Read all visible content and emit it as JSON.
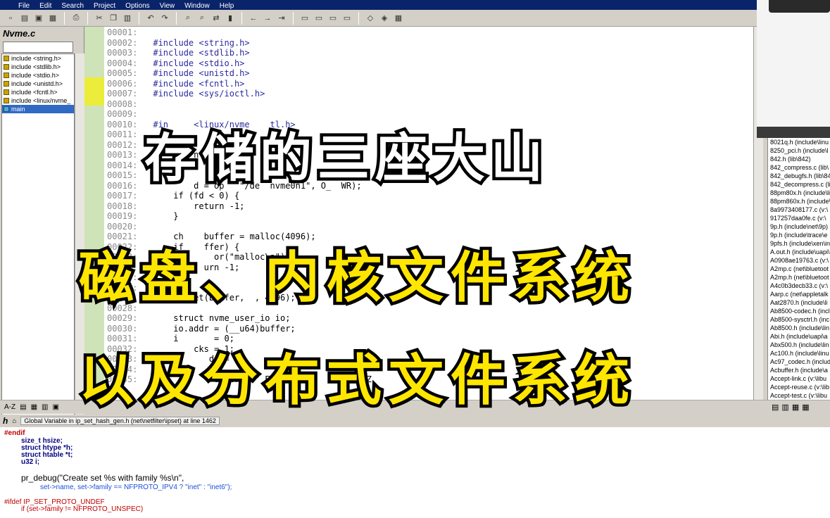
{
  "window": {
    "title": "",
    "menu": [
      "File",
      "Edit",
      "Search",
      "Project",
      "Options",
      "View",
      "Window",
      "Help"
    ]
  },
  "toolbar_icons": [
    "new-file-icon",
    "open-icon",
    "save-icon",
    "save-all-icon",
    "print-icon",
    "cut-icon",
    "copy-icon",
    "paste-icon",
    "undo-icon",
    "redo-icon",
    "find-icon",
    "find-next-icon",
    "replace-icon",
    "bookmark-icon",
    "back-icon",
    "forward-icon",
    "jump-icon",
    "layout-icon",
    "window-icon",
    "symbol-icon"
  ],
  "left_panel": {
    "title": "Nvme.c",
    "symbols": [
      {
        "label": "include <string.h>",
        "selected": false
      },
      {
        "label": "include <stdlib.h>",
        "selected": false
      },
      {
        "label": "include <stdio.h>",
        "selected": false
      },
      {
        "label": "include <unistd.h>",
        "selected": false
      },
      {
        "label": "include <fcntl.h>",
        "selected": false
      },
      {
        "label": "include <linux/nvme_",
        "selected": false
      },
      {
        "label": "main",
        "selected": true
      }
    ]
  },
  "editor": {
    "lines": [
      {
        "n": "00001:",
        "code": ""
      },
      {
        "n": "00002:",
        "code": "#include <string.h>"
      },
      {
        "n": "00003:",
        "code": "#include <stdlib.h>"
      },
      {
        "n": "00004:",
        "code": "#include <stdio.h>"
      },
      {
        "n": "00005:",
        "code": "#include <unistd.h>"
      },
      {
        "n": "00006:",
        "code": "#include <fcntl.h>"
      },
      {
        "n": "00007:",
        "code": "#include <sys/ioctl.h>"
      },
      {
        "n": "00008:",
        "code": ""
      },
      {
        "n": "00009:",
        "code": ""
      },
      {
        "n": "00010:",
        "code": "#in     <linux/nvme    tl.h>"
      },
      {
        "n": "00011:",
        "code": ""
      },
      {
        "n": "00012:",
        "code": ""
      },
      {
        "n": "00013:",
        "code": "        n()"
      },
      {
        "n": "00014:",
        "code": ""
      },
      {
        "n": "00015:",
        "code": ""
      },
      {
        "n": "00016:",
        "code": "        d = op   \"/de  nvme0n1\", O_  WR);"
      },
      {
        "n": "00017:",
        "code": "    if (fd < 0) {"
      },
      {
        "n": "00018:",
        "code": "        return -1;"
      },
      {
        "n": "00019:",
        "code": "    }"
      },
      {
        "n": "00020:",
        "code": ""
      },
      {
        "n": "00021:",
        "code": "    ch    buffer = malloc(4096);"
      },
      {
        "n": "00022:",
        "code": "    if    ffer) {"
      },
      {
        "n": "00023:",
        "code": "            or(\"malloc\\n\");"
      },
      {
        "n": "00024:",
        "code": "          urn -1;"
      },
      {
        "n": "00025:",
        "code": ""
      },
      {
        "n": "00026:",
        "code": ""
      },
      {
        "n": "00027:",
        "code": "    memset(buffer,  , 4096);"
      },
      {
        "n": "00028:",
        "code": ""
      },
      {
        "n": "00029:",
        "code": "    struct nvme_user_io io;"
      },
      {
        "n": "00030:",
        "code": "    io.addr = (__u64)buffer;"
      },
      {
        "n": "00031:",
        "code": "    i       = 0;"
      },
      {
        "n": "00032:",
        "code": "        cks = 1;"
      },
      {
        "n": "00033:",
        "code": "           de = "
      },
      {
        "n": "00034:",
        "code": ""
      },
      {
        "n": "00035:",
        "code": "            uffer,    EFGHIJ        TUVWXYZ"
      }
    ]
  },
  "right_files": [
    "8021q.h (include\\linu",
    "8250_pci.h (include\\l",
    "842.h (lib\\842)",
    "842_compress.c (lib\\",
    "842_debugfs.h (lib\\84",
    "842_decompress.c (li",
    "88pm80x.h (include\\li",
    "88pm860x.h (include\\",
    "8a9973408177.c (v:\\",
    "917257daa0fe.c (v:\\",
    "9p.h (include\\net\\9p)",
    "9p.h (include\\trace\\e",
    "9pfs.h (include\\xen\\in",
    "A.out.h (include\\uapi\\",
    "A0908ae19763.c (v:\\",
    "A2mp.c (net\\bluetoot",
    "A2mp.h (net\\bluetoot",
    "A4c0b3decb33.c (v:\\",
    "Aarp.c (net\\appletalk",
    "Aat2870.h (include\\li",
    "Ab8500-codec.h (incl",
    "Ab8500-sysctrl.h (inc",
    "Ab8500.h (include\\lin",
    "Abi.h (include\\uapi\\a",
    "Abx500.h (include\\lin",
    "Ac100.h (include\\linu",
    "Ac97_codec.h (includ",
    "Acbuffer.h (include\\a",
    "Accept-link.c (v:\\libu",
    "Accept-reuse.c (v:\\lib",
    "Accept-test.c (v:\\libu"
  ],
  "context": {
    "symbol_name": "h",
    "info": "Global Variable in ip_set_hash_gen.h (net\\netfilter\\ipset) at line 1462",
    "lines": [
      "#endif",
      "size_t hsize;",
      "struct htype *h;",
      "struct htable *t;",
      "u32 i;",
      "pr_debug(\"Create set %s with family %s\\n\",",
      "set->name, set->family == NFPROTO_IPV4 ? \"inet\" : \"inet6\");",
      "#ifdef IP_SET_PROTO_UNDEF",
      "if (set->family != NFPROTO_UNSPEC)"
    ]
  },
  "bottom_strip": {
    "sort_label": "A-Z"
  },
  "overlay": {
    "title": "存储的三座大山",
    "line2": "磁盘、内核文件系统",
    "line3": "以及分布式文件系统"
  },
  "colors": {
    "overlay_white": "#ffffff",
    "overlay_yellow": "#ffe600",
    "selection_blue": "#316ac5"
  }
}
